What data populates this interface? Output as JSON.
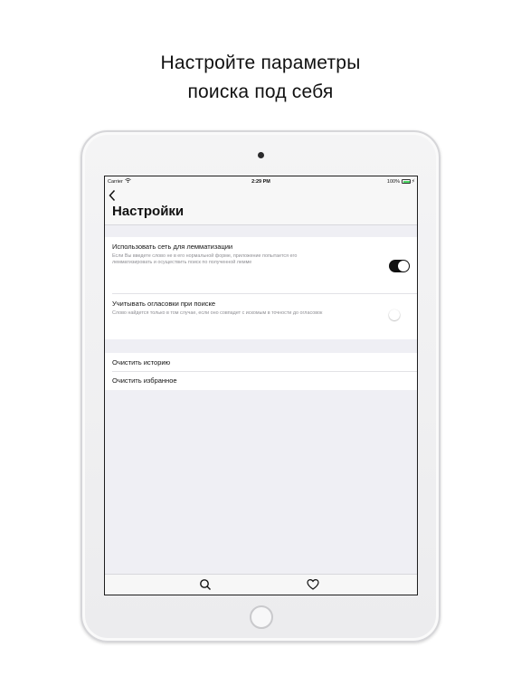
{
  "promo": {
    "line1": "Настройте параметры",
    "line2": "поиска под себя"
  },
  "status_bar": {
    "carrier": "Carrier",
    "time": "2:29 PM",
    "battery": "100%"
  },
  "nav": {
    "back_icon": "chevron-left-icon",
    "title": "Настройки"
  },
  "settings": {
    "lemmatization": {
      "label": "Использовать сеть для лемматизации",
      "description": "Если Вы введете слово не в его нормальной форме, приложение попытается его лемматизировать и осуществить поиск по полученной лемме",
      "enabled": true
    },
    "diacritics": {
      "label": "Учитывать огласовки при поиске",
      "description": "Слово найдется только в том случае, если оно совпадет с искомым в точности до огласовок",
      "enabled": false
    }
  },
  "actions": {
    "clear_history": "Очистить историю",
    "clear_favorites": "Очистить избранное"
  },
  "tabbar": {
    "items": [
      {
        "icon": "search-icon"
      },
      {
        "icon": "heart-icon"
      }
    ]
  },
  "colors": {
    "switch_on": "#111111",
    "background": "#efeff4",
    "secondary_text": "#8e8e93"
  }
}
